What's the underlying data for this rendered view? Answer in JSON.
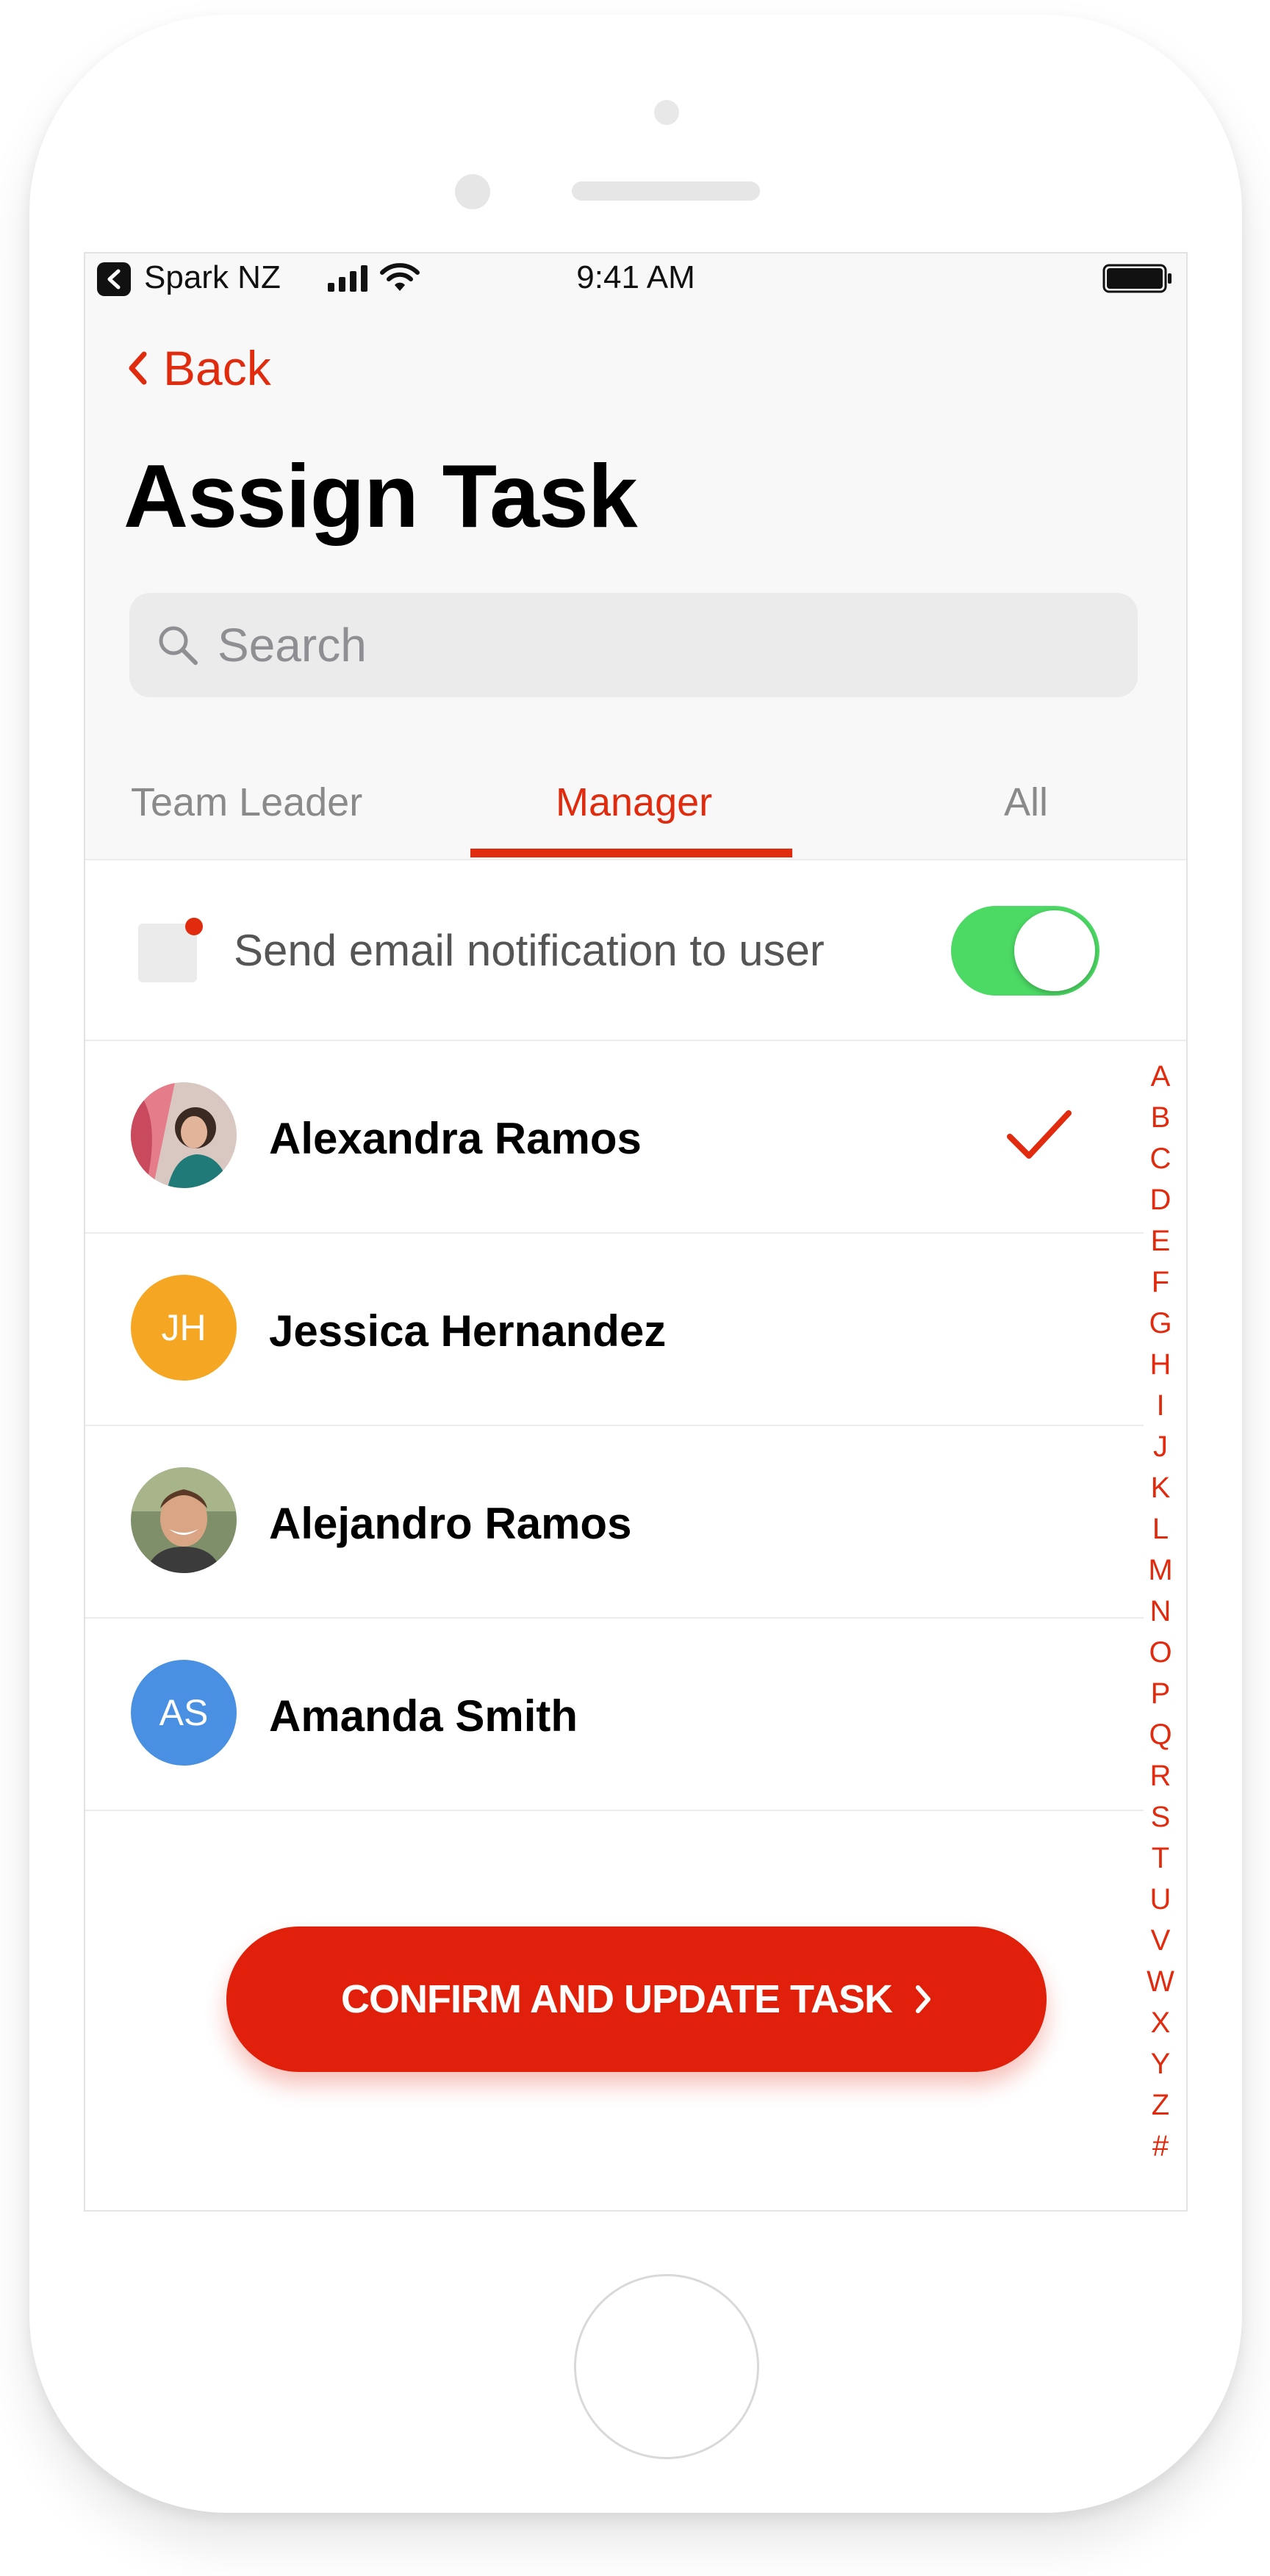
{
  "status_bar": {
    "carrier": "Spark NZ",
    "time": "9:41 AM"
  },
  "nav": {
    "back_label": "Back",
    "title": "Assign Task"
  },
  "search": {
    "placeholder": "Search"
  },
  "tabs": [
    {
      "label": "Team Leader",
      "active": false
    },
    {
      "label": "Manager",
      "active": true
    },
    {
      "label": "All",
      "active": false
    }
  ],
  "notification": {
    "label": "Send email notification to user",
    "enabled": true
  },
  "contacts": [
    {
      "name": "Alexandra Ramos",
      "initials": "",
      "avatar": "photo-woman",
      "selected": true
    },
    {
      "name": "Jessica Hernandez",
      "initials": "JH",
      "avatar": "initials",
      "avatar_color": "#f5a623",
      "selected": false
    },
    {
      "name": "Alejandro Ramos",
      "initials": "",
      "avatar": "photo-man",
      "selected": false
    },
    {
      "name": "Amanda Smith",
      "initials": "AS",
      "avatar": "initials",
      "avatar_color": "#4a90e2",
      "selected": false
    }
  ],
  "alphabet_index": [
    "A",
    "B",
    "C",
    "D",
    "E",
    "F",
    "G",
    "H",
    "I",
    "J",
    "K",
    "L",
    "M",
    "N",
    "O",
    "P",
    "Q",
    "R",
    "S",
    "T",
    "U",
    "V",
    "W",
    "X",
    "Y",
    "Z",
    "#"
  ],
  "confirm_button": {
    "label": "CONFIRM AND UPDATE TASK"
  },
  "colors": {
    "accent": "#e02b0f",
    "toggle_on": "#4cd964"
  }
}
